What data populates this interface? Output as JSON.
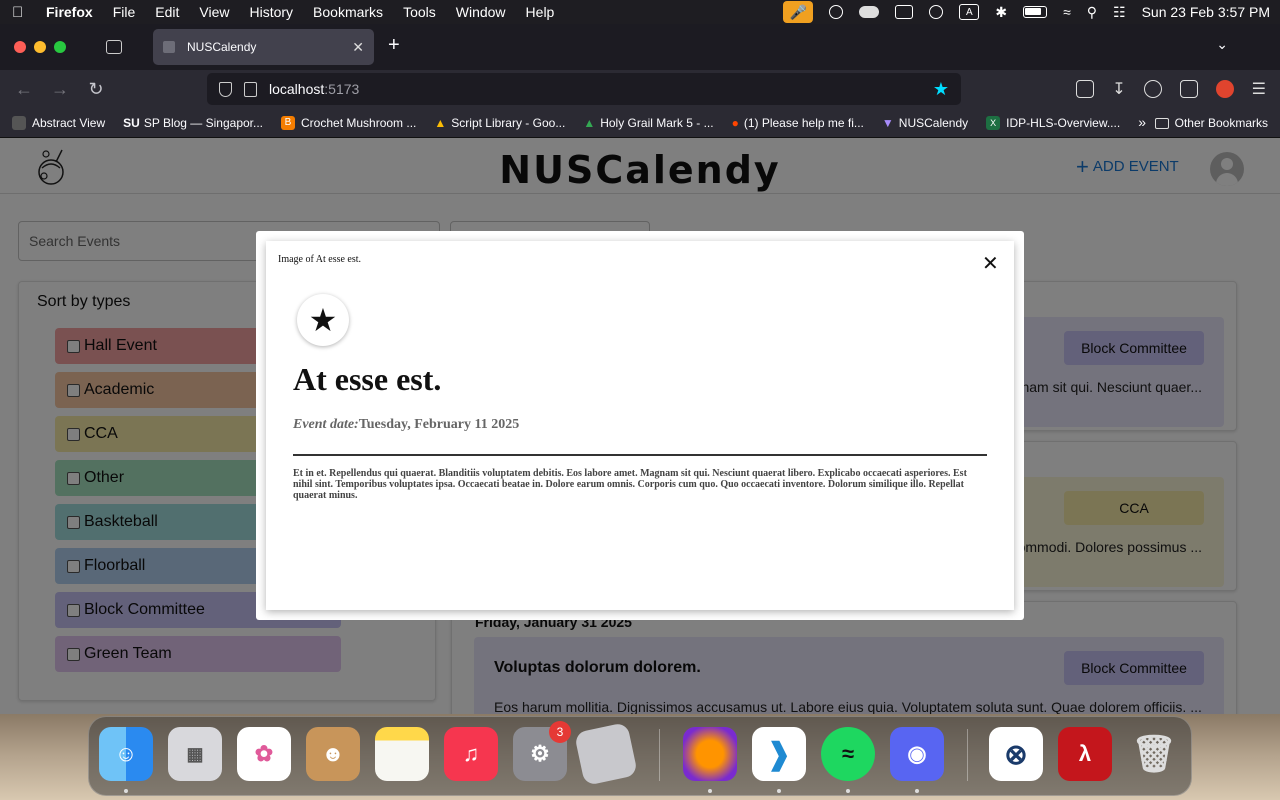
{
  "menubar": {
    "app": "Firefox",
    "items": [
      "File",
      "Edit",
      "View",
      "History",
      "Bookmarks",
      "Tools",
      "Window",
      "Help"
    ],
    "clock": "Sun 23 Feb  3:57 PM",
    "input_source": "A"
  },
  "browser": {
    "tab_title": "NUSCalendy",
    "url_host": "localhost",
    "url_port": ":5173",
    "bookmarks": [
      "Abstract View",
      "SP Blog — Singapor...",
      "Crochet Mushroom ...",
      "Script Library - Goo...",
      "Holy Grail Mark 5 - ...",
      "(1) Please help me fi...",
      "NUSCalendy",
      "IDP-HLS-Overview...."
    ],
    "bookmark_icons": [
      "SU",
      "B",
      "▲",
      "▲",
      "●",
      "▼",
      "X"
    ],
    "other_bookmarks": "Other Bookmarks"
  },
  "app": {
    "brand": "NUSCalendy",
    "add_event_label": "ADD EVENT",
    "search_placeholder": "Search Events",
    "sort_title": "Sort by types",
    "types": [
      {
        "label": "Hall Event",
        "color": "#f4a3a3"
      },
      {
        "label": "Academic",
        "color": "#f7c6a3"
      },
      {
        "label": "CCA",
        "color": "#f7eba8"
      },
      {
        "label": "Other",
        "color": "#a6e3c0"
      },
      {
        "label": "Baskteball",
        "color": "#a3dede"
      },
      {
        "label": "Floorball",
        "color": "#b3d0f0"
      },
      {
        "label": "Block Committee",
        "color": "#c6c2f5"
      },
      {
        "label": "Green Team",
        "color": "#e2c6f0"
      }
    ],
    "events": [
      {
        "title": "",
        "tag": "Block Committee",
        "desc": "...nam sit qui. Nesciunt quaer...",
        "color": "#e9e6fb",
        "tag_color": "#c6c2f5"
      },
      {
        "title": "",
        "tag": "CCA",
        "desc": "...ommodi. Dolores possimus ...",
        "color": "#fbf6d9",
        "tag_color": "#f7eba8"
      },
      {
        "title": "Voluptas dolorum dolorem.",
        "tag": "Block Committee",
        "desc": "Eos harum mollitia. Dignissimos accusamus ut. Labore eius quia. Voluptatem soluta sunt. Quae dolorem officiis. ...",
        "color": "#e9e6fb",
        "tag_color": "#c6c2f5"
      }
    ],
    "day_label": "Friday, January 31 2025"
  },
  "modal": {
    "image_alt": "Image of At esse est.",
    "close_label": "✕",
    "icon": "★",
    "title": "At esse est.",
    "date_label": "Event date:",
    "date_value": "Tuesday, February 11 2025",
    "body": "Et in et. Repellendus qui quaerat. Blanditiis voluptatem debitis. Eos labore amet. Magnam sit qui. Nesciunt quaerat libero. Explicabo occaecati asperiores. Est nihil sint. Temporibus voluptates ipsa. Occaecati beatae in. Dolore earum omnis. Corporis cum quo. Quo occaecati inventore. Dolorum similique illo. Repellat quaerat minus."
  },
  "dock": {
    "notification_badge": "3",
    "apps": [
      "finder",
      "launchpad",
      "photos",
      "contacts",
      "notes",
      "music",
      "system-settings",
      "roblox",
      "firefox",
      "vscode",
      "spotify",
      "discord",
      "xquartz",
      "acrobat",
      "trash"
    ]
  }
}
